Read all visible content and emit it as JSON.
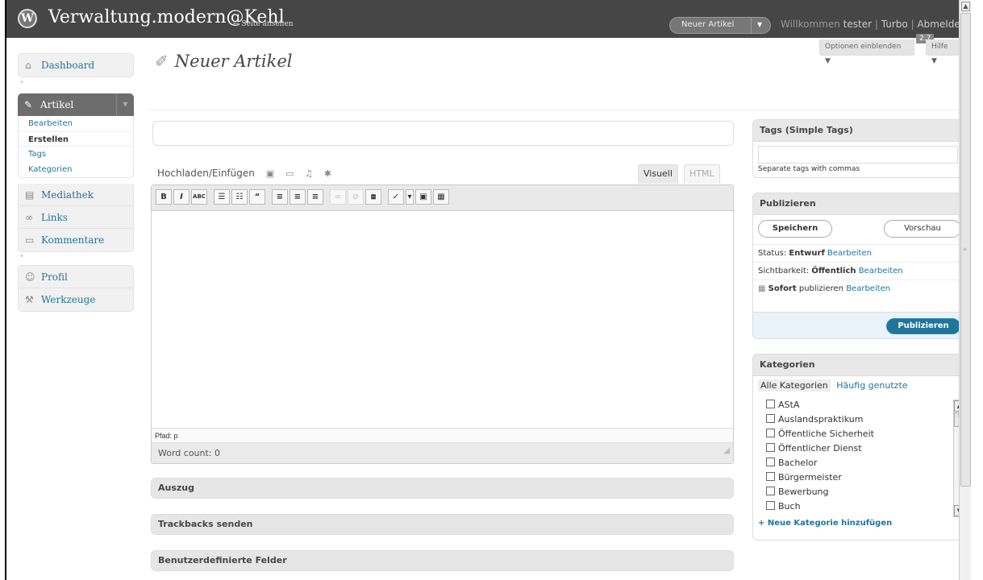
{
  "header": {
    "site_title": "Verwaltung.modern@Kehl",
    "site_link": "← Seite ansehen",
    "new_post_label": "Neuer Artikel",
    "welcome_prefix": "Willkommen",
    "username": "tester",
    "link_turbo": "Turbo",
    "link_logout": "Abmelden",
    "separator": "|",
    "version": "2.7"
  },
  "screen_meta": {
    "options_label": "Optionen einblenden ▼",
    "help_label": "Hilfe ▼"
  },
  "sidebar": {
    "dashboard": "Dashboard",
    "artikel": {
      "label": "Artikel",
      "items": [
        "Bearbeiten",
        "Erstellen",
        "Tags",
        "Kategorien"
      ]
    },
    "group2": [
      "Mediathek",
      "Links",
      "Kommentare"
    ],
    "group3": [
      "Profil",
      "Werkzeuge"
    ]
  },
  "main": {
    "page_title": "Neuer Artikel",
    "media_label": "Hochladen/Einfügen",
    "tab_visual": "Visuell",
    "tab_html": "HTML",
    "path_label": "Pfad: p",
    "word_count_label": "Word count:",
    "word_count_value": "0",
    "toolbar": [
      "B",
      "I",
      "ABC",
      "☰",
      "☷",
      "“",
      "≡",
      "≡",
      "≡",
      "∞",
      "⊘",
      "⧈",
      "✓",
      "▾",
      "▣",
      "▦"
    ],
    "boxes": {
      "excerpt": "Auszug",
      "trackbacks": "Trackbacks senden",
      "custom_fields": "Benutzerdefinierte Felder"
    }
  },
  "tags_box": {
    "title": "Tags (Simple Tags)",
    "hint": "Separate tags with commas"
  },
  "publish_box": {
    "title": "Publizieren",
    "save": "Speichern",
    "preview": "Vorschau",
    "status_label": "Status:",
    "status_value": "Entwurf",
    "visibility_label": "Sichtbarkeit:",
    "visibility_value": "Öffentlich",
    "schedule_value": "Sofort",
    "schedule_label": "publizieren",
    "edit_link": "Bearbeiten",
    "publish_button": "Publizieren"
  },
  "categories_box": {
    "title": "Kategorien",
    "tab_all": "Alle Kategorien",
    "tab_popular": "Häufig genutzte",
    "items": [
      "AStA",
      "Auslandspraktikum",
      "Öffentliche Sicherheit",
      "Öffentlicher Dienst",
      "Bachelor",
      "Bürgermeister",
      "Bewerbung",
      "Buch"
    ],
    "add_link": "+ Neue Kategorie hinzufügen"
  },
  "colors": {
    "header_bg": "#464646",
    "link": "#21759b",
    "publish_button": "#21759b",
    "menu_active": "#6d6d6d"
  }
}
